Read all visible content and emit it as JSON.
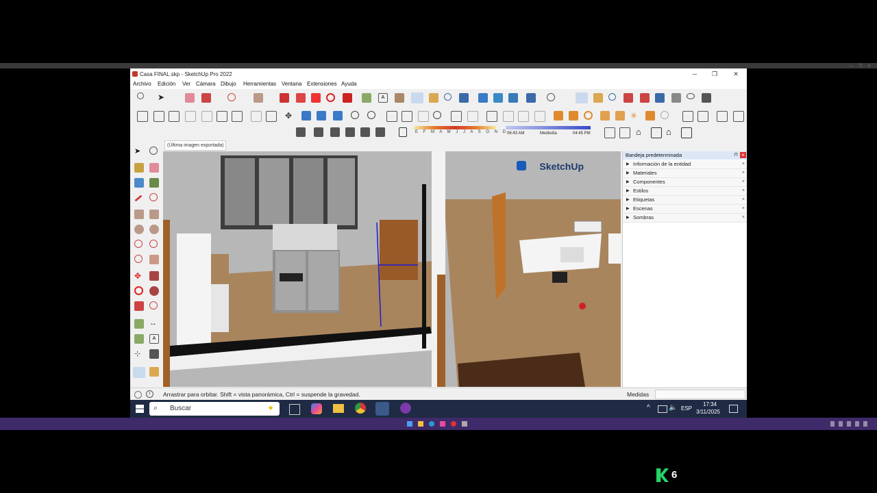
{
  "window": {
    "title": "Casa FINAL.skp - SketchUp Pro 2022",
    "minimize": "─",
    "maximize": "❐",
    "close": "✕"
  },
  "menu": [
    "Archivo",
    "Edición",
    "Ver",
    "Cámara",
    "Dibujo",
    "Herramientas",
    "Ventana",
    "Extensiones",
    "Ayuda"
  ],
  "shadow_bar": {
    "months": "E F M A M J J A S O N D",
    "time_start": "06:43 AM",
    "time_mid": "Mediodía",
    "time_end": "04:45 PM"
  },
  "scene_tab": "(Última imagen exportada)",
  "viewport": {
    "watermark": "SketchUp"
  },
  "tray": {
    "title": "Bandeja predeterminada",
    "pin": "⊓",
    "close": "×",
    "items": [
      {
        "label": "Información de la entidad",
        "close": "×"
      },
      {
        "label": "Materiales",
        "close": "×"
      },
      {
        "label": "Componentes",
        "close": "×"
      },
      {
        "label": "Estilos",
        "close": "×"
      },
      {
        "label": "Etiquetas",
        "close": "×"
      },
      {
        "label": "Escenas",
        "close": "×"
      },
      {
        "label": "Sombras",
        "close": "×"
      }
    ]
  },
  "status": {
    "message": "Arrastrar para orbitar. Shift = vista panorámica, Ctrl = suspende la gravedad.",
    "measures_label": "Medidas"
  },
  "taskbar": {
    "search_label": "Buscar",
    "tray_chevron": "^",
    "lang": "ESP",
    "time": "17:34",
    "date": "3/11/2025"
  },
  "overlay": {
    "logo_number": "6"
  },
  "colors": {
    "accent": "#0067c0",
    "taskbar": "#1f2a44",
    "purple_bar": "#3f2a6a",
    "floor": "#a9855e",
    "logo_green": "#25d366"
  }
}
